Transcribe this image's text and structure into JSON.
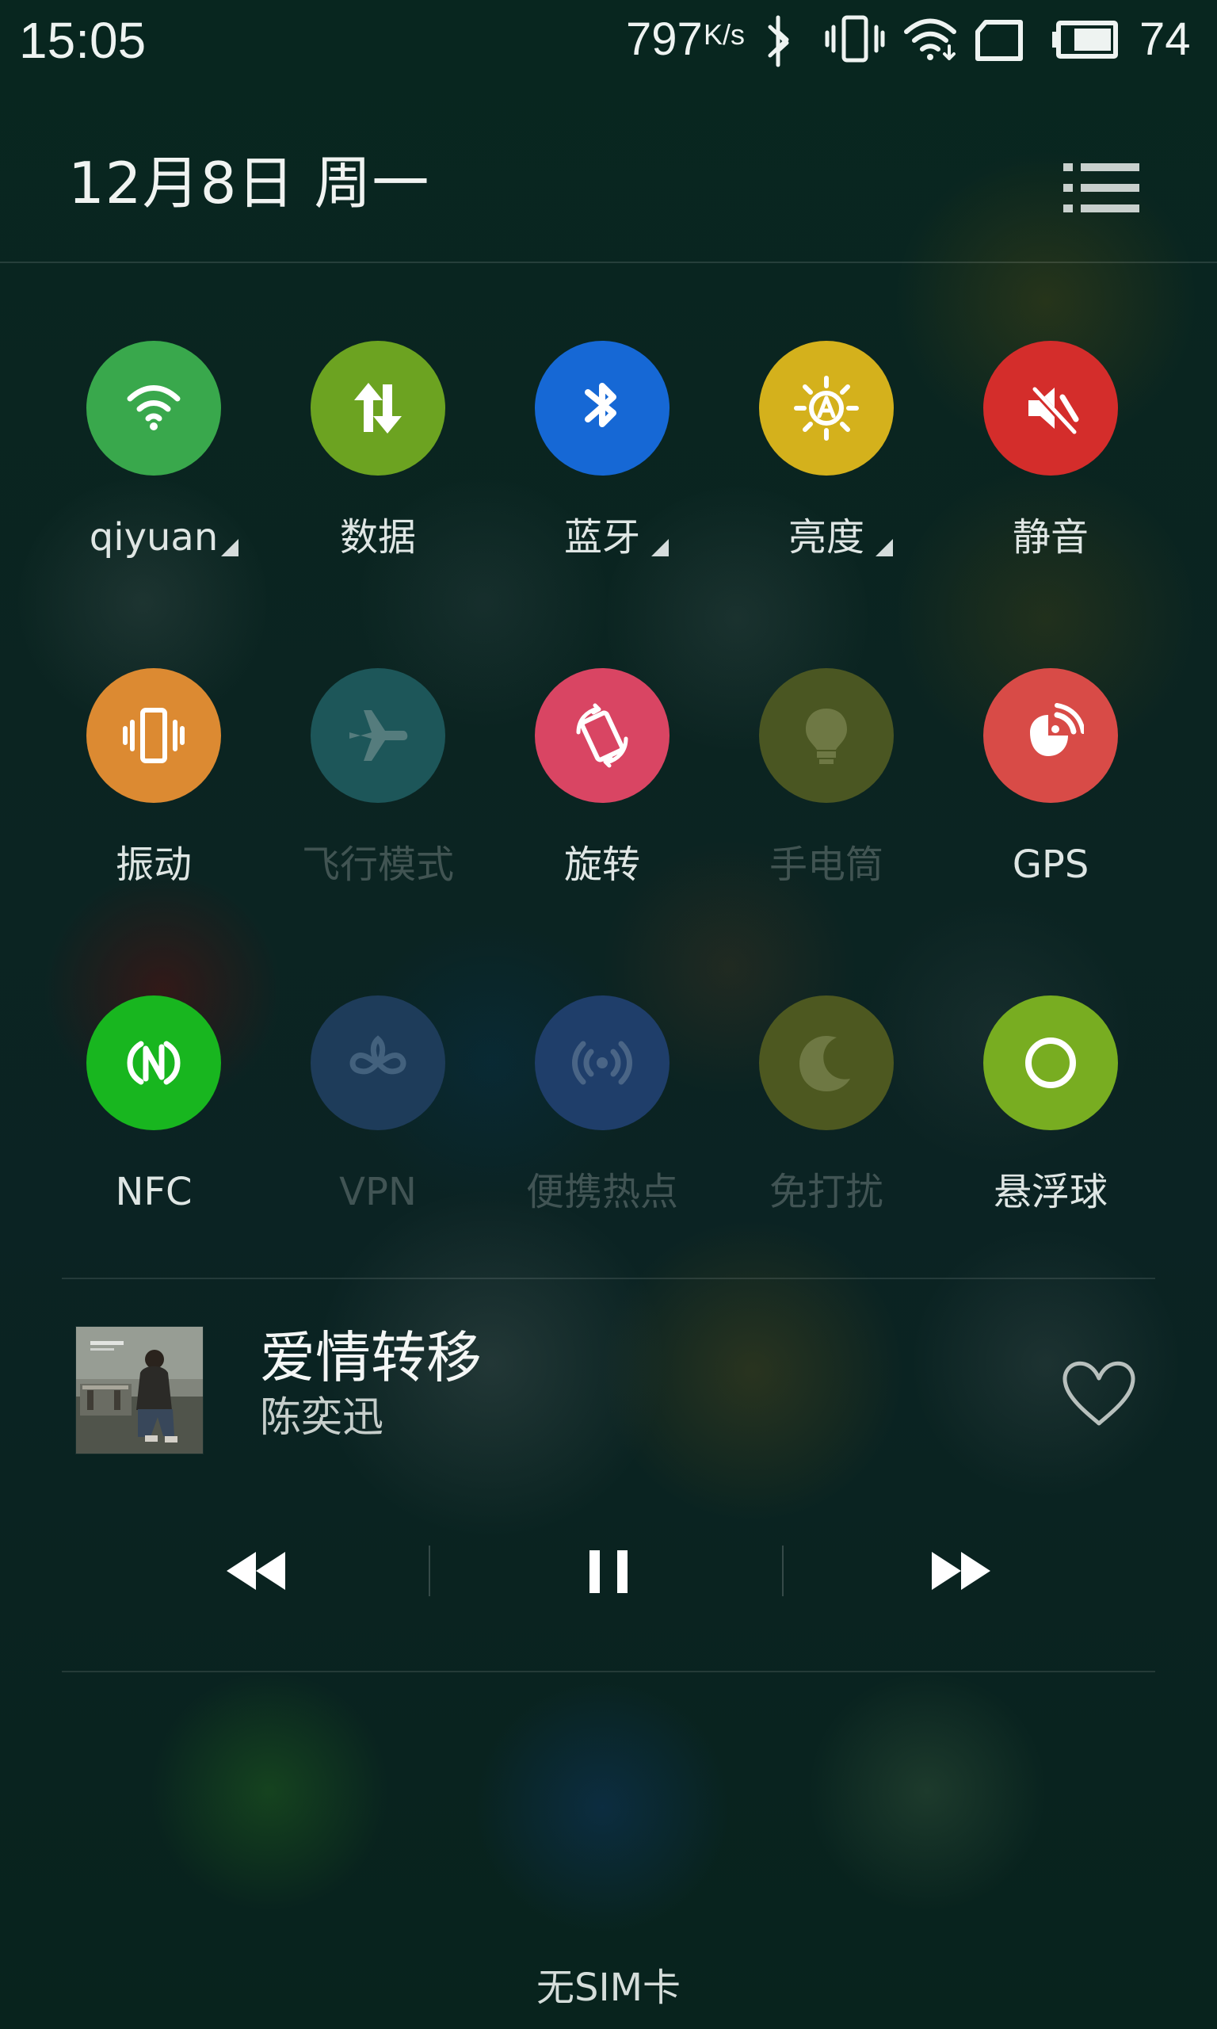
{
  "status_bar": {
    "time": "15:05",
    "network_speed": "797",
    "network_speed_unit": "K/s",
    "battery_level": "74",
    "icons": [
      "bluetooth-icon",
      "vibrate-icon",
      "wifi-icon",
      "no-sim-icon",
      "battery-icon"
    ]
  },
  "header": {
    "date": "12月8日  周一",
    "menu_icon": "list-menu-icon"
  },
  "toggles": [
    {
      "label": "qiyuan",
      "icon": "wifi-icon",
      "active": true,
      "color": "#39a84c",
      "has_dropdown": true
    },
    {
      "label": "数据",
      "icon": "data-transfer-icon",
      "active": true,
      "color": "#6ca321",
      "has_dropdown": false
    },
    {
      "label": "蓝牙",
      "icon": "bluetooth-icon",
      "active": true,
      "color": "#1668d5",
      "has_dropdown": true
    },
    {
      "label": "亮度",
      "icon": "auto-brightness-icon",
      "active": true,
      "color": "#d4b11c",
      "has_dropdown": true
    },
    {
      "label": "静音",
      "icon": "mute-icon",
      "active": true,
      "color": "#d42d2b",
      "has_dropdown": false
    },
    {
      "label": "振动",
      "icon": "vibrate-icon",
      "active": true,
      "color": "#dc8a32",
      "has_dropdown": false
    },
    {
      "label": "飞行模式",
      "icon": "airplane-icon",
      "active": false,
      "color": "#1d5659",
      "has_dropdown": false
    },
    {
      "label": "旋转",
      "icon": "rotate-icon",
      "active": true,
      "color": "#d94563",
      "has_dropdown": false
    },
    {
      "label": "手电筒",
      "icon": "flashlight-icon",
      "active": false,
      "color": "#4a5622",
      "has_dropdown": false
    },
    {
      "label": "GPS",
      "icon": "gps-icon",
      "active": true,
      "color": "#d84b47",
      "has_dropdown": false
    },
    {
      "label": "NFC",
      "icon": "nfc-icon",
      "active": true,
      "color": "#18b61f",
      "has_dropdown": false
    },
    {
      "label": "VPN",
      "icon": "vpn-icon",
      "active": false,
      "color": "#1e3c5a",
      "has_dropdown": false
    },
    {
      "label": "便携热点",
      "icon": "hotspot-icon",
      "active": false,
      "color": "#1f3e6a",
      "has_dropdown": false
    },
    {
      "label": "免打扰",
      "icon": "moon-icon",
      "active": false,
      "color": "#4d5820",
      "has_dropdown": false
    },
    {
      "label": "悬浮球",
      "icon": "floating-ball-icon",
      "active": true,
      "color": "#78ad21",
      "has_dropdown": false
    }
  ],
  "music": {
    "title": "爱情转移",
    "artist": "陈奕迅",
    "album_art": "album-art-image",
    "favorite_icon": "heart-icon",
    "controls": [
      "previous-icon",
      "pause-icon",
      "next-icon"
    ]
  },
  "footer": {
    "sim_status": "无SIM卡"
  }
}
